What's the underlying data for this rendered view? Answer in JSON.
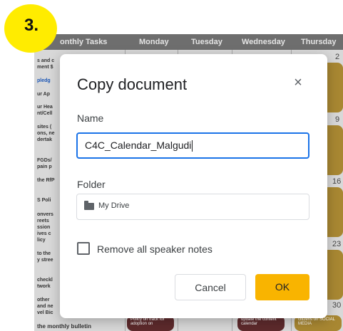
{
  "step_badge": {
    "label": "3."
  },
  "background_sheet": {
    "headers": [
      "onthly Tasks",
      "Monday",
      "Tuesday",
      "Wednesday",
      "Thursday"
    ],
    "day_numbers": [
      "2",
      "9",
      "16",
      "23",
      "30"
    ],
    "left_fragments": [
      "s and c",
      "ment $",
      "pledg",
      "ur Ap",
      "ur Hea",
      "nt/Cell",
      "sites (",
      "ons, ne",
      "dertak",
      "FGDs/",
      "pain p",
      "the RfP",
      "S Poli",
      "onvers",
      "reets",
      "ssion",
      "ives c",
      "licy",
      "to the",
      "y stree",
      "checkl",
      "twork",
      "other",
      "and ne",
      "vel Bic",
      "the monthly bulletin"
    ],
    "chips": [
      {
        "text": "Policy on track for adoption on",
        "color": "maroon"
      },
      {
        "text": "update the content calendar",
        "color": "maroon"
      },
      {
        "text": "citizens on SOCIAL MEDIA",
        "color": "gold"
      }
    ]
  },
  "dialog": {
    "title": "Copy document",
    "close_symbol": "×",
    "name_label": "Name",
    "name_value": "C4C_Calendar_Malgudi",
    "folder_label": "Folder",
    "folder_value": "My Drive",
    "remove_notes_label": "Remove all speaker notes",
    "cancel_label": "Cancel",
    "ok_label": "OK"
  },
  "colors": {
    "accent_blue": "#1a73e8",
    "ok_button": "#f9b400",
    "badge_yellow": "#ffec00"
  }
}
